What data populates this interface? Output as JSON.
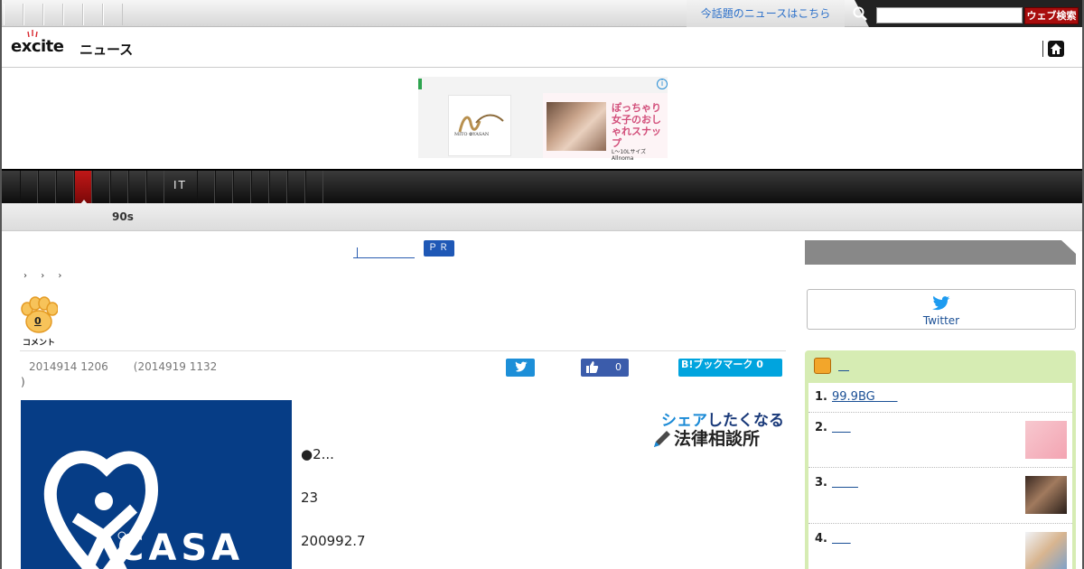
{
  "topbar": {
    "news_link": "今話題のニュースはこちら",
    "search_placeholder": "",
    "search_button": "ウェブ検索"
  },
  "header": {
    "logo_text": "excite",
    "logo_sub": "ニュース"
  },
  "ad": {
    "brand": "MITO ✿YASAN",
    "banner_text": "ぽっちゃり女子のおしゃれスナップ",
    "banner_footer": "L〜10Lサイズ Allnoma"
  },
  "category_nav": {
    "active_label": "IT"
  },
  "subnav": {
    "item": "90s"
  },
  "pr": {
    "badge": "ＰＲ"
  },
  "breadcrumb": [
    "›",
    "›",
    "›"
  ],
  "comments": {
    "count": "0",
    "label": "コメント"
  },
  "article": {
    "posted": "2014914 1206",
    "updated": "(2014919 1132",
    "updated_close": ")",
    "lines": [
      "●2...",
      "23",
      "200992.7"
    ],
    "image_label": "CASA"
  },
  "share": {
    "fb_count": "0",
    "hatena_label": "B!ブックマーク 0"
  },
  "lawyer_badge": {
    "top_blue": "シェア",
    "top_rest": "したくなる",
    "bottom": "法律相談所"
  },
  "sidebar": {
    "twitter_label": "Twitter",
    "ranking": [
      {
        "num": "1.",
        "title": "99.9BG      "
      },
      {
        "num": "2.",
        "title": "     "
      },
      {
        "num": "3.",
        "title": "       "
      },
      {
        "num": "4.",
        "title": "     "
      }
    ]
  },
  "colors": {
    "search_button": "#a80d0d",
    "nav_active": "#c01818",
    "pr_badge": "#1f58b6",
    "ranking_bg": "#d6ecb3",
    "casa_blue": "#063d86"
  }
}
